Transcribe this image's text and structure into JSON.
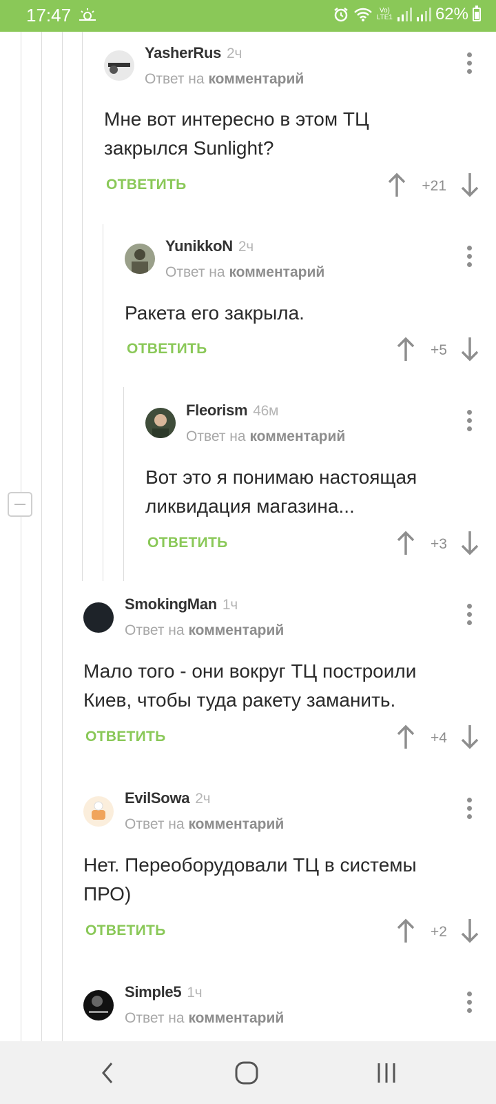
{
  "status_bar": {
    "time": "17:47",
    "battery": "62%",
    "network": "LTE1"
  },
  "thread": {
    "reply_to_prefix": "Ответ на",
    "reply_to_link": "комментарий",
    "reply_label": "ОТВЕТИТЬ"
  },
  "comments": [
    {
      "author": "YasherRus",
      "age": "2ч",
      "text_lines": [
        "Мне вот интересно в этом ТЦ",
        "закрылся Sunlight?"
      ],
      "score": "+21"
    },
    {
      "author": "YunikkoN",
      "age": "2ч",
      "text_lines": [
        "Ракета его закрыла."
      ],
      "score": "+5"
    },
    {
      "author": "Fleorism",
      "age": "46м",
      "text_lines": [
        "Вот это я понимаю настоящая",
        "ликвидация магазина..."
      ],
      "score": "+3"
    },
    {
      "author": "SmokingMan",
      "age": "1ч",
      "text_lines": [
        "Мало того -  они вокруг ТЦ построили",
        "Киев, чтобы туда ракету заманить."
      ],
      "score": "+4"
    },
    {
      "author": "EvilSowa",
      "age": "2ч",
      "text_lines": [
        "Нет. Переоборудовали ТЦ в системы",
        "ПРО)"
      ],
      "score": "+2"
    },
    {
      "author": "Simple5",
      "age": "1ч",
      "text_lines": [],
      "score": ""
    }
  ],
  "colors": {
    "accent": "#8ac858",
    "status_bar": "#8ac858"
  },
  "icons": [
    "alarm-icon",
    "wifi-icon",
    "signal-icon",
    "battery-icon",
    "weather-icon",
    "more-vertical-icon",
    "arrow-up-icon",
    "arrow-down-icon",
    "back-icon",
    "home-icon",
    "recents-icon",
    "collapse-icon"
  ]
}
